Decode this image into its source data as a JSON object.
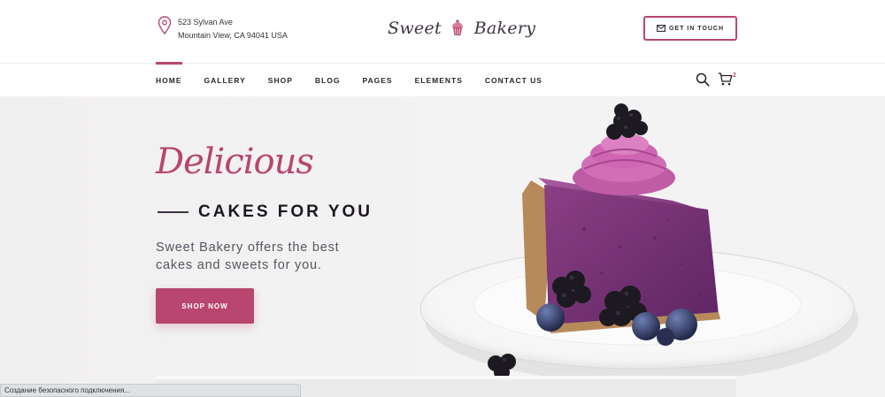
{
  "header": {
    "address_line1": "523 Sylvan Ave",
    "address_line2": "Mountain View, CA 94041 USA",
    "logo_word1": "Sweet",
    "logo_word2": "Bakery",
    "cta_label": "GET IN TOUCH",
    "icons": {
      "location": "map-pin-icon",
      "cta": "envelope-icon",
      "logo": "cupcake-icon"
    }
  },
  "nav": {
    "items": [
      {
        "label": "HOME",
        "active": true
      },
      {
        "label": "GALLERY"
      },
      {
        "label": "SHOP"
      },
      {
        "label": "BLOG"
      },
      {
        "label": "PAGES"
      },
      {
        "label": "ELEMENTS"
      },
      {
        "label": "CONTACT US"
      }
    ],
    "cart_count": "2",
    "icons": {
      "search": "search-icon",
      "cart": "cart-icon"
    }
  },
  "hero": {
    "script_title": "Delicious",
    "headline": "CAKES FOR YOU",
    "description": "Sweet Bakery offers the best cakes and sweets for you.",
    "button_label": "SHOP NOW"
  },
  "status_bar": {
    "text": "Создание безопасного подключения..."
  },
  "colors": {
    "accent": "#b8466f",
    "hero_bg": "#f2f1f1",
    "dark_text": "#1c1720"
  }
}
